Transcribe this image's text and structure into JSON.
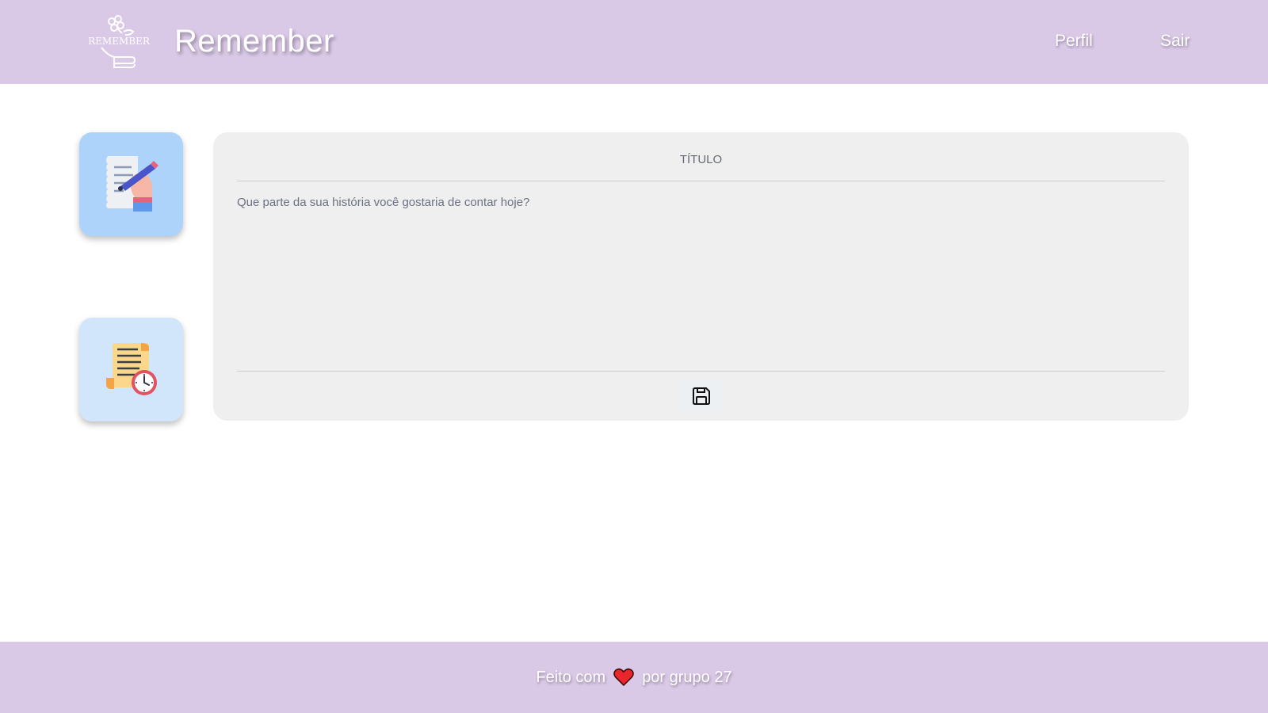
{
  "header": {
    "brand": "Remember",
    "logo_text": "REMEMBER",
    "nav": {
      "perfil": "Perfil",
      "sair": "Sair"
    },
    "background": "#dac8e7"
  },
  "sidebar": {
    "items": [
      {
        "name": "write-memory",
        "icon": "hand-writing-icon",
        "background": "#aed3fb"
      },
      {
        "name": "memory-history",
        "icon": "scroll-clock-icon",
        "background": "#d1e5fb"
      }
    ]
  },
  "editor": {
    "title_placeholder": "TÍTULO",
    "body_placeholder": "Que parte da sua história você gostaria de contar hoje?",
    "save_icon": "floppy-disk-icon"
  },
  "footer": {
    "prefix": "Feito com",
    "icon": "heart-icon",
    "suffix": "por grupo 27"
  }
}
